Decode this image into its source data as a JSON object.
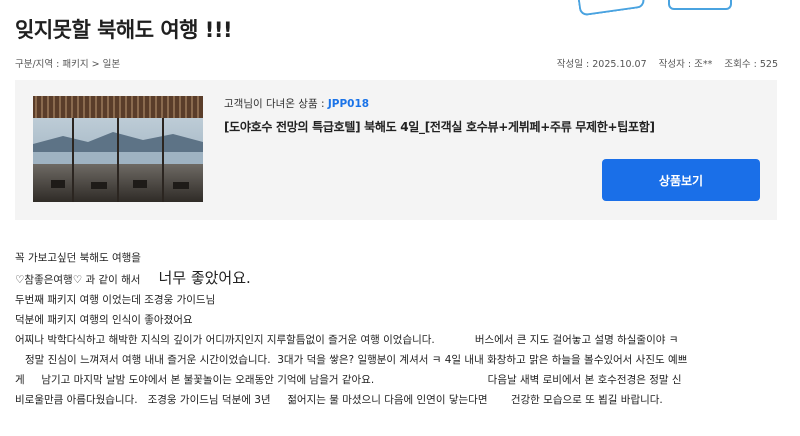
{
  "review": {
    "title": "잊지못할 북해도 여행 !!!",
    "breadcrumb": "구분/지역 : 패키지 > 일본",
    "date": "작성일 : 2025.10.07",
    "author": "작성자 : 조**",
    "views": "조회수 : 525",
    "lines": [
      "꼭 가보고싶던 북해도 여행을",
      "두번째 패키지 여행 이었는데 조경웅 가이드님",
      "덕분에 패키지 여행의 인식이 좋아졌어요",
      "어찌나 박학다식하고 해박한 지식의 깊이가 어디까지인지 지루할틈없이 즐거운 여행 이었습니다.            버스에서 큰 지도 걸어놓고 설명 하실줄이야 ㅋ",
      "   정말 진심이 느껴져서 여행 내내 즐거운 시간이었습니다.  3대가 덕을 쌓은? 일행분이 계셔서 ㅋ 4일 내내 화창하고 맑은 하늘을 볼수있어서 사진도 예쁘",
      "게     남기고 마지막 날밤 도야에서 본 불꽃놀이는 오래동안 기억에 남을거 같아요.                                  다음날 새벽 로비에서 본 호수전경은 정말 신",
      "비로울만큼 아름다웠습니다.   조경웅 가이드님 덕분에 3년     젊어지는 물 마셨으니 다음에 인연이 닿는다면       건강한 모습으로 또 뵙길 바랍니다."
    ],
    "line2_start": "♡참좋은여행♡ 과 같이 해서",
    "line2_big": "너무 좋았어요."
  },
  "product": {
    "lead_text": "고객님이 다녀온 상품 :",
    "code": "JPP018",
    "name": "[도야호수 전망의 특급호텔] 북해도 4일_[전객실 호수뷰+게뷔페+주류 무제한+팁포함]",
    "button_label": "상품보기",
    "image": "hotel-lobby-lake-view"
  },
  "colors": {
    "accent": "#1a6fe8",
    "code": "#1a73e8",
    "box_bg": "#f4f4f4"
  }
}
